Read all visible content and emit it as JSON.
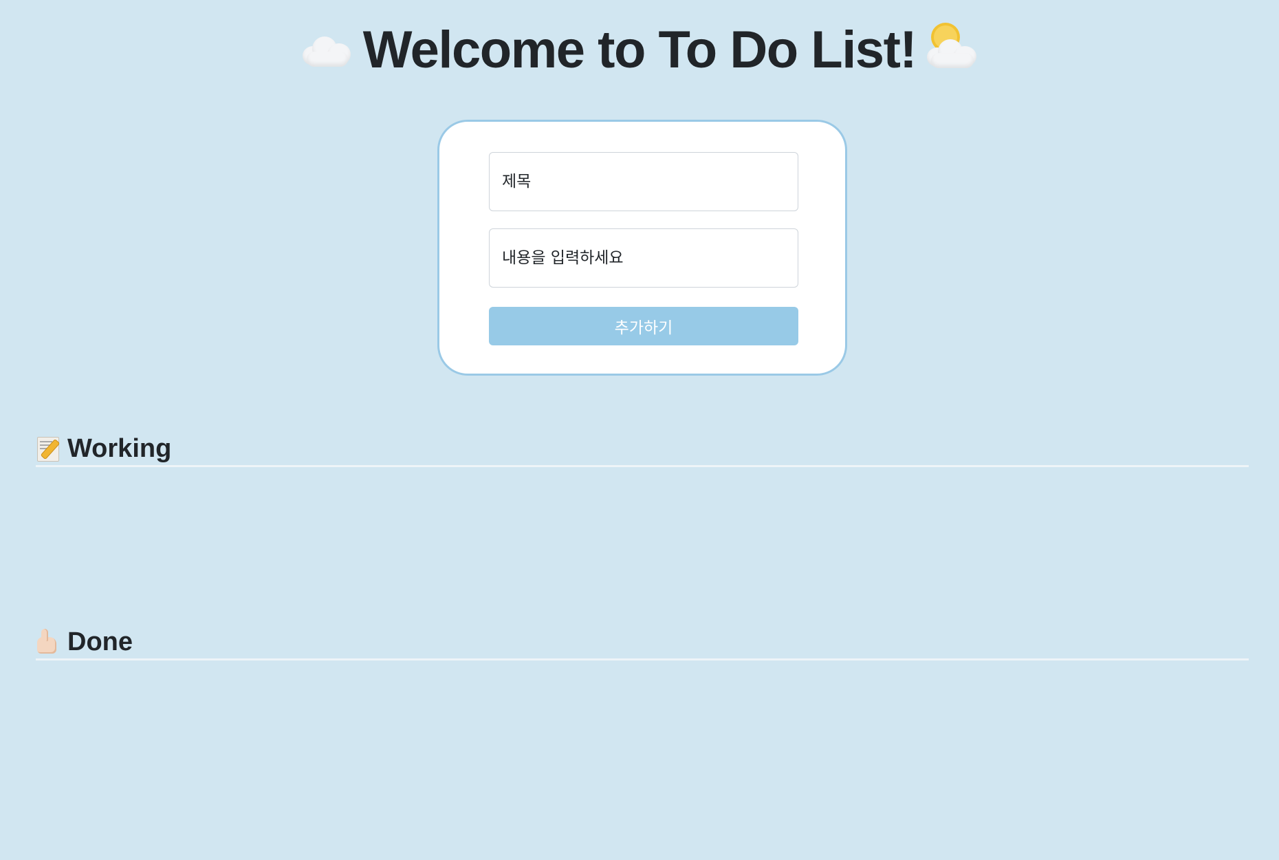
{
  "header": {
    "title": "Welcome to To Do List!",
    "left_icon": "cloud-icon",
    "right_icon": "sun-behind-cloud-icon"
  },
  "form": {
    "title_placeholder": "제목",
    "content_placeholder": "내용을 입력하세요",
    "add_button_label": "추가하기"
  },
  "sections": {
    "working": {
      "label": "Working",
      "icon": "memo-icon",
      "items": []
    },
    "done": {
      "label": "Done",
      "icon": "thumbs-up-icon",
      "items": []
    }
  },
  "colors": {
    "background": "#d1e6f1",
    "card": "#ffffff",
    "card_border": "#9ac9e6",
    "button": "#97cae7",
    "text": "#212529"
  }
}
